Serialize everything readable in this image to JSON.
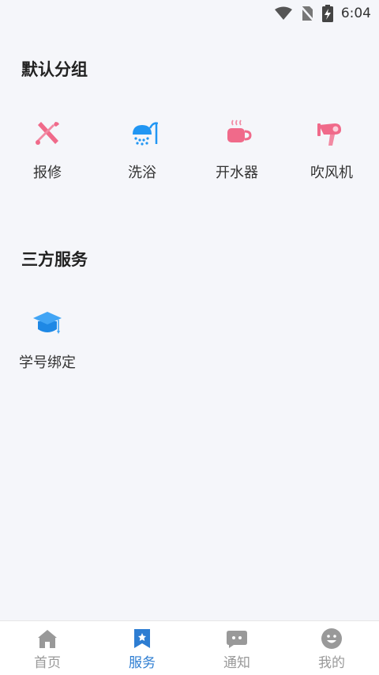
{
  "status_bar": {
    "time": "6:04"
  },
  "sections": [
    {
      "title": "默认分组",
      "items": [
        {
          "label": "报修",
          "icon": "repair-tools-icon"
        },
        {
          "label": "洗浴",
          "icon": "shower-icon"
        },
        {
          "label": "开水器",
          "icon": "hot-water-cup-icon"
        },
        {
          "label": "吹风机",
          "icon": "hair-dryer-icon"
        }
      ]
    },
    {
      "title": "三方服务",
      "items": [
        {
          "label": "学号绑定",
          "icon": "graduation-cap-icon"
        }
      ]
    }
  ],
  "tabbar": {
    "tabs": [
      {
        "label": "首页",
        "icon": "home-icon",
        "active": false
      },
      {
        "label": "服务",
        "icon": "service-bookmark-icon",
        "active": true
      },
      {
        "label": "通知",
        "icon": "message-icon",
        "active": false
      },
      {
        "label": "我的",
        "icon": "profile-face-icon",
        "active": false
      }
    ]
  },
  "colors": {
    "accent": "#2d7dd2",
    "inactive": "#999999",
    "background": "#f5f6fa",
    "pink": "#f06a8a",
    "blue": "#2196f3"
  }
}
